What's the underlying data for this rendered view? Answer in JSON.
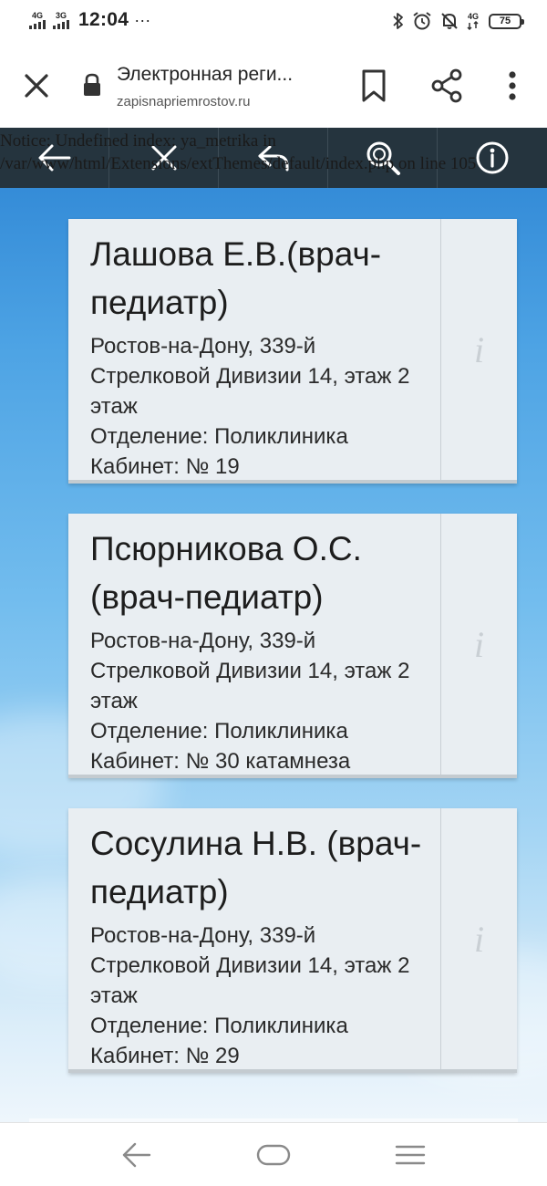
{
  "status_bar": {
    "network1": "4G",
    "network2": "3G",
    "time": "12:04",
    "dots": "···",
    "network3": "4G",
    "battery": "75"
  },
  "browser": {
    "title": "Электронная реги...",
    "url": "zapisnapriemrostov.ru"
  },
  "toolbar": {
    "buttons": [
      "back-arrow-icon",
      "close-icon",
      "undo-icon",
      "search-icon",
      "info-icon"
    ]
  },
  "notice": {
    "text": "Notice: Undefined index: ya_metrika in /var/www/html/Extensions/extThemes/default/index.php on line 105"
  },
  "doctors": [
    {
      "name": "Лашова Е.В.(врач-педиатр)",
      "address": "Ростов-на-Дону, 339-й Стрелковой Дивизии 14, этаж 2 этаж",
      "department": "Отделение: Поликлиника",
      "room": "Кабинет: № 19",
      "info": "i"
    },
    {
      "name": "Псюрникова О.С. (врач-педиатр)",
      "address": "Ростов-на-Дону, 339-й Стрелковой Дивизии 14, этаж 2 этаж",
      "department": "Отделение: Поликлиника",
      "room": "Кабинет: № 30 катамнеза",
      "info": "i"
    },
    {
      "name": "Сосулина Н.В. (врач-педиатр)",
      "address": "Ростов-на-Дону, 339-й Стрелковой Дивизии 14, этаж 2 этаж",
      "department": "Отделение: Поликлиника",
      "room": "Кабинет: № 29",
      "info": "i"
    }
  ],
  "colors": {
    "toolbar_bg": "#25343e",
    "card_bg": "#e9eef2",
    "sky_top": "#2b83d3",
    "sky_bottom": "#eef6fc"
  }
}
